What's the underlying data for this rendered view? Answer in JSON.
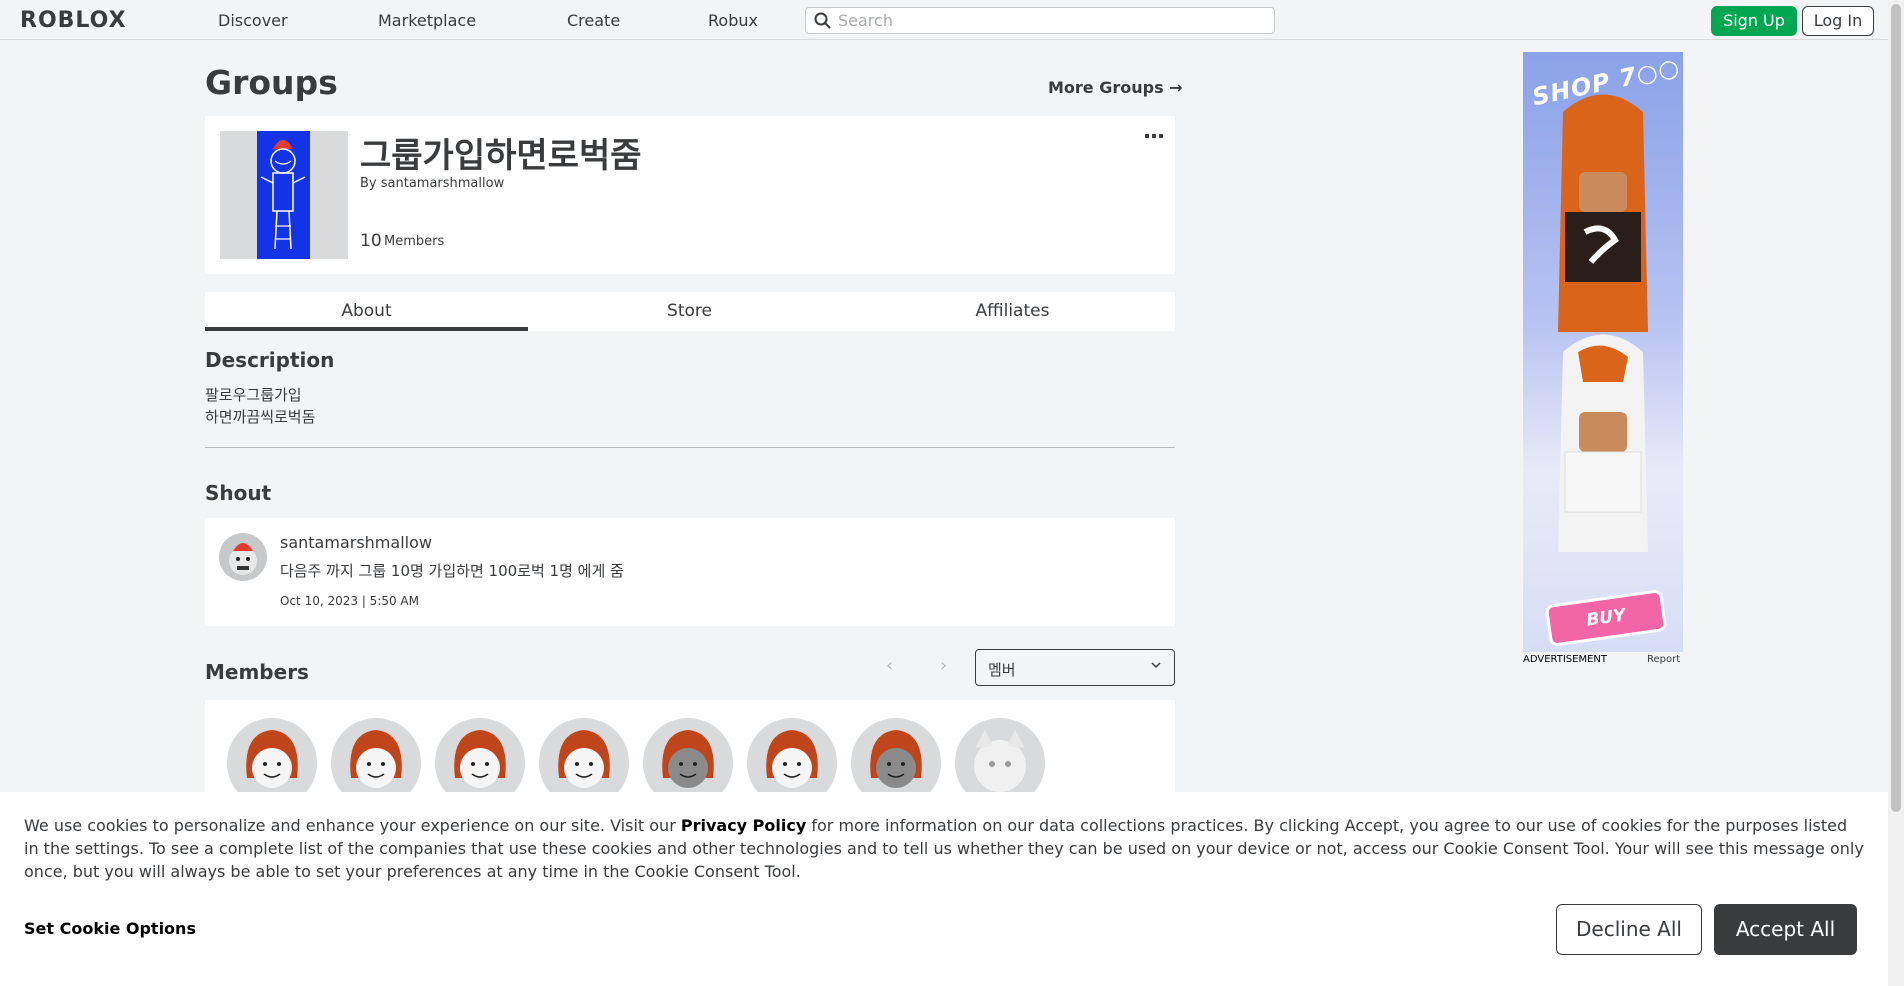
{
  "header": {
    "logo": "ROBLOX",
    "nav": [
      "Discover",
      "Marketplace",
      "Create",
      "Robux"
    ],
    "search_placeholder": "Search",
    "signup_label": "Sign Up",
    "login_label": "Log In"
  },
  "page": {
    "title": "Groups",
    "more_groups": "More Groups →"
  },
  "group": {
    "name": "그룹가입하면로벅줌",
    "owner": "By santamarshmallow",
    "member_count": "10",
    "member_label": "Members",
    "menu_icon": "more-dots-icon"
  },
  "tabs": [
    {
      "label": "About",
      "active": true
    },
    {
      "label": "Store",
      "active": false
    },
    {
      "label": "Affiliates",
      "active": false
    }
  ],
  "description": {
    "title": "Description",
    "text": "팔로우그룹가입\n하면까끔씩로벅돔"
  },
  "shout": {
    "title": "Shout",
    "user": "santamarshmallow",
    "message": "다음주 까지 그룹 10명 가입하면 100로벅 1명 에게 줌",
    "time": "Oct 10, 2023 | 5:50 AM"
  },
  "members": {
    "title": "Members",
    "role_selected": "멤버",
    "count_shown": 8
  },
  "ad": {
    "headline": "SHOP 7○○",
    "buy": "BUY",
    "label": "ADVERTISEMENT",
    "report": "Report"
  },
  "cookie": {
    "text_before": "We use cookies to personalize and enhance your experience on our site. Visit our ",
    "policy_link": "Privacy Policy",
    "text_after": " for more information on our data collections practices. By clicking Accept, you agree to our use of cookies for the purposes listed in the settings. To see a complete list of the companies that use these cookies and other technologies and to tell us whether they can be used on your device or not, access our Cookie Consent Tool. Your will see this message only once, but you will always be able to set your preferences at any time in the Cookie Consent Tool.",
    "options": "Set Cookie Options",
    "decline": "Decline All",
    "accept": "Accept All"
  },
  "colors": {
    "accent_green": "#00a650",
    "text_dark": "#393b3d",
    "page_bg": "#f2f4f5",
    "emblem_blue": "#1233e6"
  }
}
